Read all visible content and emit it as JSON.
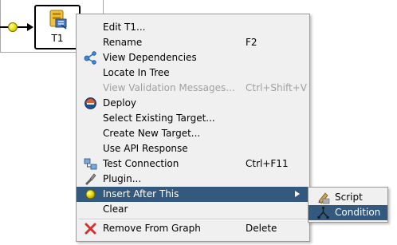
{
  "graph": {
    "node_label": "T1"
  },
  "context_menu": {
    "items": [
      {
        "label": "Edit T1...",
        "shortcut": "",
        "icon": "",
        "enabled": true
      },
      {
        "label": "Rename",
        "shortcut": "F2",
        "icon": "",
        "enabled": true
      },
      {
        "label": "View Dependencies",
        "shortcut": "",
        "icon": "dependencies-icon",
        "enabled": true
      },
      {
        "label": "Locate In Tree",
        "shortcut": "",
        "icon": "",
        "enabled": true
      },
      {
        "label": "View Validation Messages...",
        "shortcut": "Ctrl+Shift+V",
        "icon": "",
        "enabled": false
      },
      {
        "label": "Deploy",
        "shortcut": "",
        "icon": "deploy-icon",
        "enabled": true
      },
      {
        "label": "Select Existing Target...",
        "shortcut": "",
        "icon": "",
        "enabled": true
      },
      {
        "label": "Create New Target...",
        "shortcut": "",
        "icon": "",
        "enabled": true
      },
      {
        "label": "Use API Response",
        "shortcut": "",
        "icon": "",
        "enabled": true
      },
      {
        "label": "Test Connection",
        "shortcut": "Ctrl+F11",
        "icon": "test-connection-icon",
        "enabled": true
      },
      {
        "label": "Plugin...",
        "shortcut": "",
        "icon": "plugin-icon",
        "enabled": true
      },
      {
        "label": "Insert After This",
        "shortcut": "",
        "icon": "insert-circle-icon",
        "enabled": true,
        "highlighted": true,
        "has_submenu": true
      },
      {
        "label": "Clear",
        "shortcut": "",
        "icon": "",
        "enabled": true
      },
      {
        "label": "Remove From Graph",
        "shortcut": "Delete",
        "icon": "remove-x-icon",
        "enabled": true
      }
    ]
  },
  "submenu": {
    "items": [
      {
        "label": "Script",
        "icon": "script-icon"
      },
      {
        "label": "Condition",
        "icon": "condition-icon",
        "highlighted": true
      }
    ]
  },
  "colors": {
    "highlight": "#33597f",
    "menu_bg": "#f0f0f0",
    "disabled_text": "#a0a0a0",
    "connector_dot": "#e6d800"
  }
}
